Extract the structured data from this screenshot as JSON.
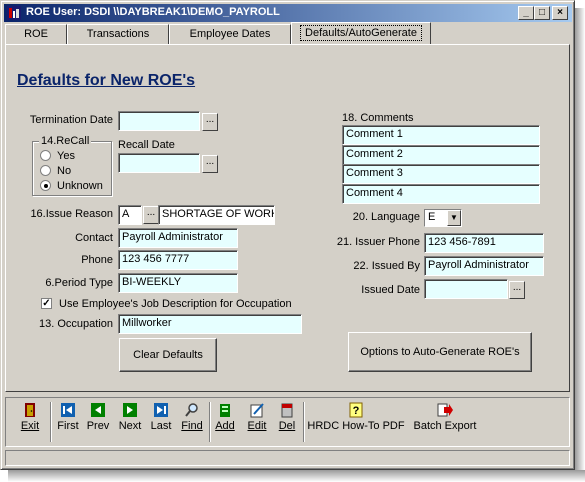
{
  "window": {
    "title": "ROE  User: DSDI  \\\\DAYBREAK1\\DEMO_PAYROLL",
    "minimize": "_",
    "maximize": "□",
    "close": "×"
  },
  "tabs": [
    "ROE",
    "Transactions",
    "Employee Dates",
    "Defaults/AutoGenerate"
  ],
  "heading": "Defaults for New ROE's",
  "form": {
    "termination_date_label": "Termination Date",
    "termination_date": "",
    "recall_group_label": "14.ReCall",
    "recall_options": [
      "Yes",
      "No",
      "Unknown"
    ],
    "recall_selected": "Unknown",
    "recall_date_label": "Recall Date",
    "recall_date": "",
    "issue_reason_label": "16.Issue Reason",
    "issue_reason_code": "A",
    "issue_reason_text": "SHORTAGE OF WORK",
    "contact_label": "Contact",
    "contact": "Payroll Administrator",
    "phone_label": "Phone",
    "phone": "123 456 7777",
    "period_type_label": "6.Period Type",
    "period_type": "BI-WEEKLY",
    "use_job_desc_label": "Use Employee's Job Description for Occupation",
    "use_job_desc_checked": true,
    "occupation_label": "13. Occupation",
    "occupation": "Millworker",
    "clear_defaults": "Clear Defaults",
    "comments_label": "18. Comments",
    "comments": [
      "Comment 1",
      "Comment 2",
      "Comment 3",
      "Comment 4"
    ],
    "language_label": "20. Language",
    "language": "E",
    "issuer_phone_label": "21. Issuer Phone",
    "issuer_phone": "123 456-7891",
    "issued_by_label": "22. Issued By",
    "issued_by": "Payroll Administrator",
    "issued_date_label": "Issued Date",
    "issued_date": "",
    "auto_generate": "Options to Auto-Generate ROE's",
    "ellipsis": "..."
  },
  "toolbar": {
    "exit": "Exit",
    "first": "First",
    "prev": "Prev",
    "next": "Next",
    "last": "Last",
    "find": "Find",
    "add": "Add",
    "edit": "Edit",
    "del": "Del",
    "hrdc": "HRDC How-To PDF",
    "batch_export": "Batch Export"
  },
  "colors": {
    "field_bg": "#e6ffff",
    "heading": "#0a246a",
    "title_start": "#0a246a",
    "title_end": "#a6caf0",
    "nav_green": "#008000",
    "nav_blue": "#1060b0"
  }
}
